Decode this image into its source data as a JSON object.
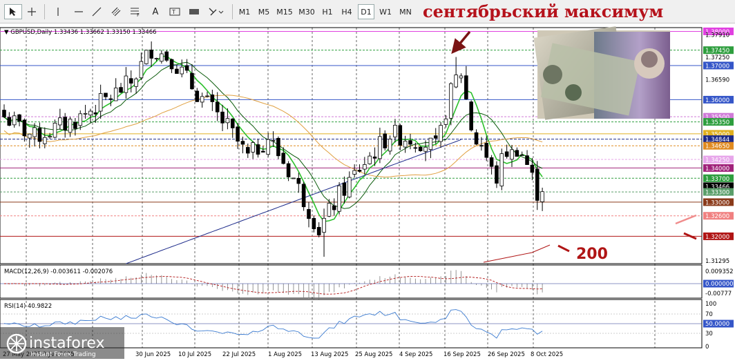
{
  "toolbar": {
    "timeframes": [
      "M1",
      "M5",
      "M15",
      "M30",
      "H1",
      "H4",
      "D1",
      "W1",
      "MN"
    ],
    "active_timeframe": "D1",
    "annotation_title": "сентябрьский максимум",
    "tools": [
      "cursor-icon",
      "crosshair-icon",
      "vertical-line-icon",
      "horizontal-line-icon",
      "trendline-icon",
      "channel-icon",
      "fibonacci-icon",
      "text-icon",
      "label-icon",
      "rectangle-icon",
      "shapes-icon"
    ]
  },
  "chart": {
    "header": "GBPUSD,Daily  1.33436 1.33662 1.33150 1.33466",
    "price_labels": [
      {
        "text": "1.38000",
        "bg": "#e040e0",
        "fg": "#ffffff",
        "price": 1.38
      },
      {
        "text": "1.37910",
        "bg": "",
        "fg": "#000000",
        "price": 1.3791
      },
      {
        "text": "1.37450",
        "bg": "#2e9e3e",
        "fg": "#ffffff",
        "price": 1.3745
      },
      {
        "text": "1.37250",
        "bg": "",
        "fg": "#000000",
        "price": 1.3725
      },
      {
        "text": "1.37000",
        "bg": "#3556c8",
        "fg": "#ffffff",
        "price": 1.37
      },
      {
        "text": "1.36590",
        "bg": "",
        "fg": "#000000",
        "price": 1.3659
      },
      {
        "text": "1.36000",
        "bg": "#3556c8",
        "fg": "#ffffff",
        "price": 1.36
      },
      {
        "text": "1.35500",
        "bg": "#d07ad8",
        "fg": "#ffffff",
        "price": 1.355
      },
      {
        "text": "1.35350",
        "bg": "#2e9e3e",
        "fg": "#ffffff",
        "price": 1.3535
      },
      {
        "text": "1.35000",
        "bg": "#e0b020",
        "fg": "#ffffff",
        "price": 1.35
      },
      {
        "text": "1.34844",
        "bg": "#1c2a8a",
        "fg": "#ffffff",
        "price": 1.34844
      },
      {
        "text": "1.34650",
        "bg": "#e08a20",
        "fg": "#ffffff",
        "price": 1.3465
      },
      {
        "text": "1.34250",
        "bg": "#e7a6ea",
        "fg": "#ffffff",
        "price": 1.3425
      },
      {
        "text": "1.34000",
        "bg": "#a0227a",
        "fg": "#ffffff",
        "price": 1.34
      },
      {
        "text": "1.33700",
        "bg": "#2e9e3e",
        "fg": "#ffffff",
        "price": 1.337
      },
      {
        "text": "1.33466",
        "bg": "#000000",
        "fg": "#ffffff",
        "price": 1.33466
      },
      {
        "text": "1.33300",
        "bg": "#5a9e6a",
        "fg": "#ffffff",
        "price": 1.333
      },
      {
        "text": "1.33000",
        "bg": "#8a3a1a",
        "fg": "#ffffff",
        "price": 1.33
      },
      {
        "text": "1.32600",
        "bg": "#f08080",
        "fg": "#ffffff",
        "price": 1.326
      },
      {
        "text": "1.32000",
        "bg": "#b01515",
        "fg": "#ffffff",
        "price": 1.32
      },
      {
        "text": "1.31295",
        "bg": "",
        "fg": "#000000",
        "price": 1.31295
      }
    ],
    "date_labels": [
      "27 May 2025",
      "9 Jun 2025",
      "30 Jun 2025",
      "10 Jul 2025",
      "22 Jul 2025",
      "1 Aug 2025",
      "13 Aug 2025",
      "25 Aug 2025",
      "4 Sep 2025",
      "16 Sep 2025",
      "26 Sep 2025",
      "8 Oct 2025"
    ],
    "annotation_200": "200",
    "macd_header": "MACD(12,26,9) -0.003611 -0.002076",
    "macd_labels": [
      "0.009352",
      "0.000000",
      "-0.00777"
    ],
    "rsi_header": "RSI(14) 40.9822",
    "rsi_labels": [
      "100",
      "70",
      "50.0000",
      "30",
      "0"
    ],
    "watermark_brand": "instaforex",
    "watermark_sub": "Instant Forex Trading"
  }
}
